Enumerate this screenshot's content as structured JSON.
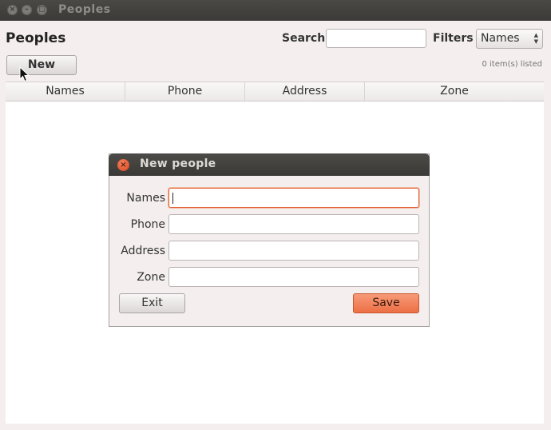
{
  "window": {
    "title": "Peoples"
  },
  "app": {
    "title": "Peoples"
  },
  "toolbar": {
    "search_label": "Search",
    "search_value": "",
    "filters_label": "Filters",
    "filters_selected": "Names",
    "new_label": "New",
    "count_text": "0 item(s) listed"
  },
  "table": {
    "columns": [
      "Names",
      "Phone",
      "Address",
      "Zone"
    ],
    "rows": []
  },
  "dialog": {
    "title": "New people",
    "fields": [
      {
        "label": "Names",
        "value": ""
      },
      {
        "label": "Phone",
        "value": ""
      },
      {
        "label": "Address",
        "value": ""
      },
      {
        "label": "Zone",
        "value": ""
      }
    ],
    "exit_label": "Exit",
    "save_label": "Save"
  },
  "colors": {
    "accent": "#f07a52",
    "titlebar": "#3c3b37",
    "window_bg": "#f4eeee"
  },
  "icons": {
    "close": "close-icon",
    "minimize": "minimize-icon",
    "maximize": "maximize-icon",
    "pointer": "mouse-pointer-icon"
  }
}
